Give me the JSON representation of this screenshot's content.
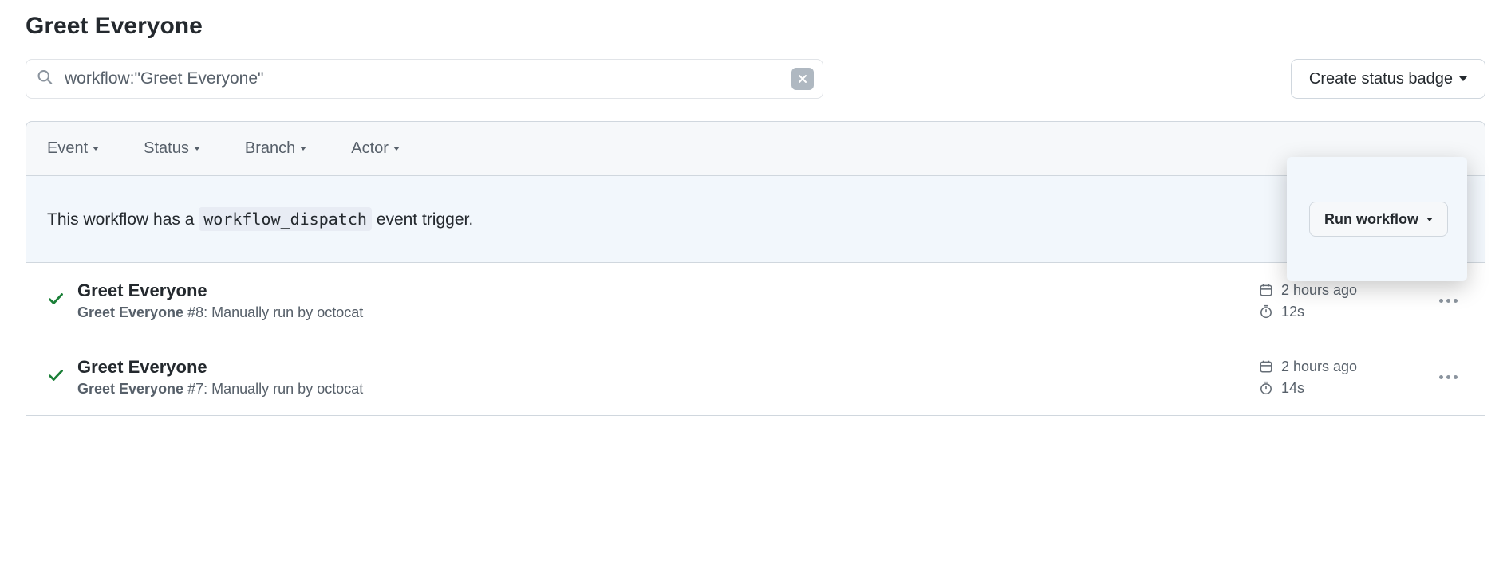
{
  "title": "Greet Everyone",
  "search": {
    "value": "workflow:\"Greet Everyone\""
  },
  "badge_button": "Create status badge",
  "filters": {
    "event": "Event",
    "status": "Status",
    "branch": "Branch",
    "actor": "Actor"
  },
  "dispatch": {
    "prefix": "This workflow has a ",
    "code": "workflow_dispatch",
    "suffix": " event trigger.",
    "run_label": "Run workflow"
  },
  "runs": [
    {
      "title": "Greet Everyone",
      "workflow_name": "Greet Everyone",
      "number": "#8",
      "trigger": ": Manually run by ",
      "actor": "octocat",
      "time": "2 hours ago",
      "duration": "12s"
    },
    {
      "title": "Greet Everyone",
      "workflow_name": "Greet Everyone",
      "number": "#7",
      "trigger": ": Manually run by ",
      "actor": "octocat",
      "time": "2 hours ago",
      "duration": "14s"
    }
  ]
}
